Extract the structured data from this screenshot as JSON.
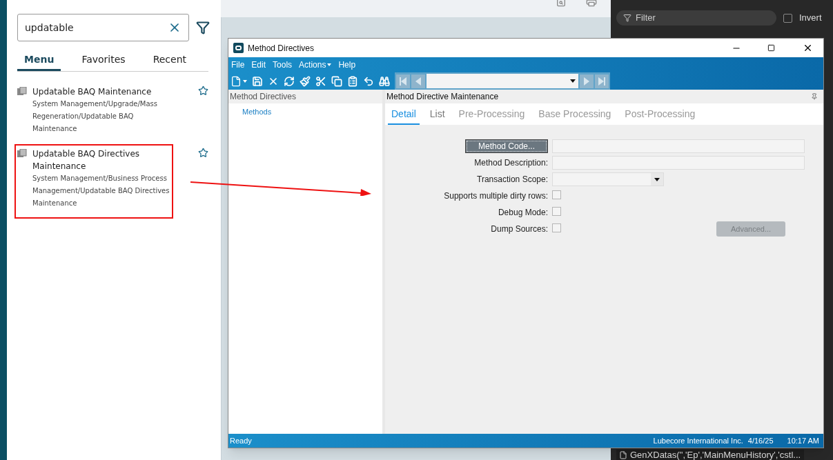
{
  "search_panel": {
    "search": {
      "value": "updatable"
    },
    "tabs": [
      {
        "label": "Menu",
        "selected": true
      },
      {
        "label": "Favorites",
        "selected": false
      },
      {
        "label": "Recent",
        "selected": false
      }
    ],
    "results": [
      {
        "title": "Updatable BAQ Maintenance",
        "path": "System Management/Upgrade/Mass Regeneration/Updatable BAQ Maintenance",
        "highlighted": false
      },
      {
        "title": "Updatable BAQ Directives Maintenance",
        "path": "System Management/Business Process Management/Updatable BAQ Directives Maintenance",
        "highlighted": true
      }
    ]
  },
  "devtools": {
    "filter": {
      "placeholder": "Filter"
    },
    "invert": {
      "label": "Invert",
      "checked": false
    },
    "console_line": "GenXDatas('','Ep','MainMenuHistory','cstl..."
  },
  "window": {
    "title": "Method Directives",
    "menu": [
      {
        "label": "File",
        "kind": "plain"
      },
      {
        "label": "Edit",
        "kind": "plain"
      },
      {
        "label": "Tools",
        "kind": "plain"
      },
      {
        "label": "Actions",
        "kind": "dropdown"
      },
      {
        "label": "Help",
        "kind": "plain"
      }
    ],
    "tree": {
      "title": "Method Directives",
      "items": [
        "Methods"
      ]
    },
    "panel": {
      "title": "Method Directive Maintenance",
      "tabs": [
        {
          "label": "Detail",
          "selected": true,
          "disabled": false
        },
        {
          "label": "List",
          "selected": false,
          "disabled": false
        },
        {
          "label": "Pre-Processing",
          "selected": false,
          "disabled": true
        },
        {
          "label": "Base Processing",
          "selected": false,
          "disabled": true
        },
        {
          "label": "Post-Processing",
          "selected": false,
          "disabled": true
        }
      ],
      "fields": [
        {
          "kind": "button",
          "label": "Method Code..."
        },
        {
          "kind": "text",
          "label": "Method Description:"
        },
        {
          "kind": "dropdown",
          "label": "Transaction Scope:"
        },
        {
          "kind": "checkbox",
          "label": "Supports multiple dirty rows:",
          "checked": false
        },
        {
          "kind": "checkbox",
          "label": "Debug Mode:",
          "checked": false
        },
        {
          "kind": "checkbox",
          "label": "Dump Sources:",
          "checked": false
        }
      ],
      "advanced_button": {
        "label": "Advanced...",
        "disabled": true
      }
    },
    "status_bar": {
      "status": "Ready",
      "company": "Lubecore International Inc.",
      "date": "4/16/25",
      "time": "10:17 AM"
    }
  }
}
